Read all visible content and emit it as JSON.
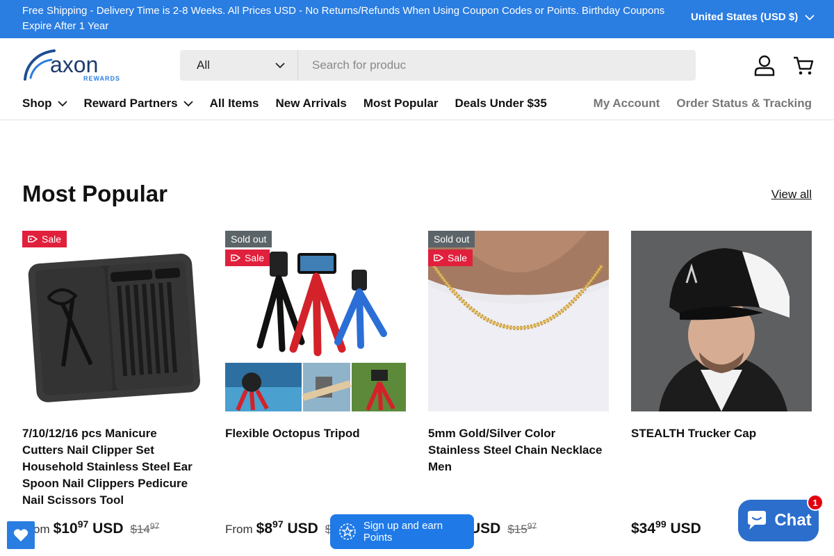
{
  "announcement": {
    "text": "Free Shipping - Delivery Time is 2-8 Weeks. All Prices USD - No Returns/Refunds When Using Coupon Codes or Points. Birthday Coupons Expire After 1 Year",
    "currency": "United States (USD $)"
  },
  "header": {
    "logo_text": "axon",
    "logo_sub": "REWARDS",
    "search": {
      "category": "All",
      "placeholder": "Search for produc"
    },
    "nav": [
      "Shop",
      "Reward Partners",
      "All Items",
      "New Arrivals",
      "Most Popular",
      "Deals Under $35"
    ],
    "nav_right": [
      "My Account",
      "Order Status & Tracking"
    ]
  },
  "section": {
    "title": "Most Popular",
    "view_all": "View all"
  },
  "products": [
    {
      "title": "7/10/12/16 pcs Manicure Cutters Nail Clipper Set Household Stainless Steel Ear Spoon Nail Clippers Pedicure Nail Scissors Tool",
      "from": "From",
      "price_main": "$10",
      "price_cents": "97",
      "currency": "USD",
      "compare_main": "$14",
      "compare_cents": "97",
      "badges": [
        "Sale"
      ]
    },
    {
      "title": "Flexible Octopus Tripod",
      "from": "From",
      "price_main": "$8",
      "price_cents": "97",
      "currency": "USD",
      "compare_main": "$",
      "compare_cents": "",
      "badges": [
        "Sold out",
        "Sale"
      ]
    },
    {
      "title": "5mm Gold/Silver Color Stainless Steel Chain Necklace Men",
      "from": "",
      "price_main": "",
      "price_cents": "",
      "currency": "USD",
      "compare_main": "$15",
      "compare_cents": "97",
      "badges": [
        "Sold out",
        "Sale"
      ]
    },
    {
      "title": "STEALTH Trucker Cap",
      "from": "",
      "price_main": "$34",
      "price_cents": "99",
      "currency": "USD",
      "compare_main": "",
      "compare_cents": "",
      "badges": []
    }
  ],
  "widgets": {
    "rewards_label": "Sign up and earn Points",
    "chat_label": "Chat",
    "chat_count": "1"
  },
  "colors": {
    "brand_blue": "#2a7de1",
    "sale_red": "#e0203c",
    "sold_grey": "#5b6468",
    "chat_blue": "#2c6ecb"
  }
}
